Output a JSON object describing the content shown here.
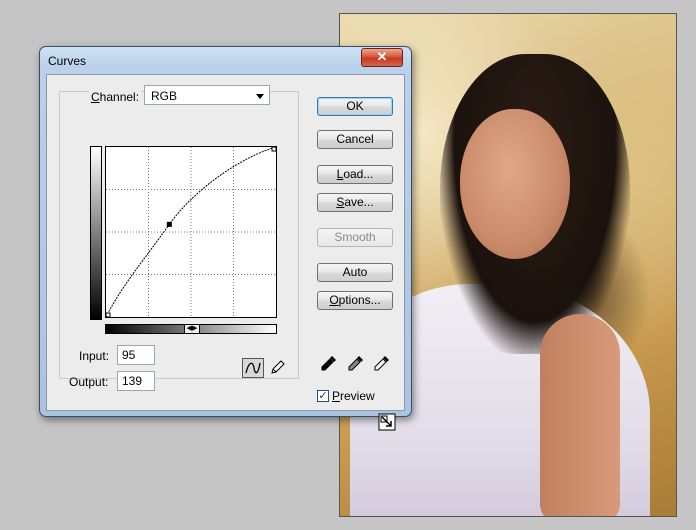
{
  "window": {
    "title": "Curves",
    "close_symbol": "✕"
  },
  "curves": {
    "channel_label_prefix": "",
    "channel_label_underlined": "C",
    "channel_label_rest": "hannel:",
    "channel_value": "RGB",
    "input_label": "Input:",
    "input_value": "95",
    "output_label": "Output:",
    "output_value": "139",
    "point": {
      "input": 95,
      "output": 139
    }
  },
  "buttons": {
    "ok": "OK",
    "cancel": "Cancel",
    "load": "Load...",
    "save": "Save...",
    "smooth": "Smooth",
    "auto": "Auto",
    "options": "Options..."
  },
  "preview": {
    "label": "Preview",
    "checked": true,
    "check_glyph": "✓"
  },
  "icons": {
    "curve_tool": "curve-tool-icon",
    "pencil_tool": "pencil-tool-icon",
    "black_eyedropper": "black-point-eyedropper-icon",
    "gray_eyedropper": "gray-point-eyedropper-icon",
    "white_eyedropper": "white-point-eyedropper-icon",
    "expand": "expand-dialog-icon"
  }
}
